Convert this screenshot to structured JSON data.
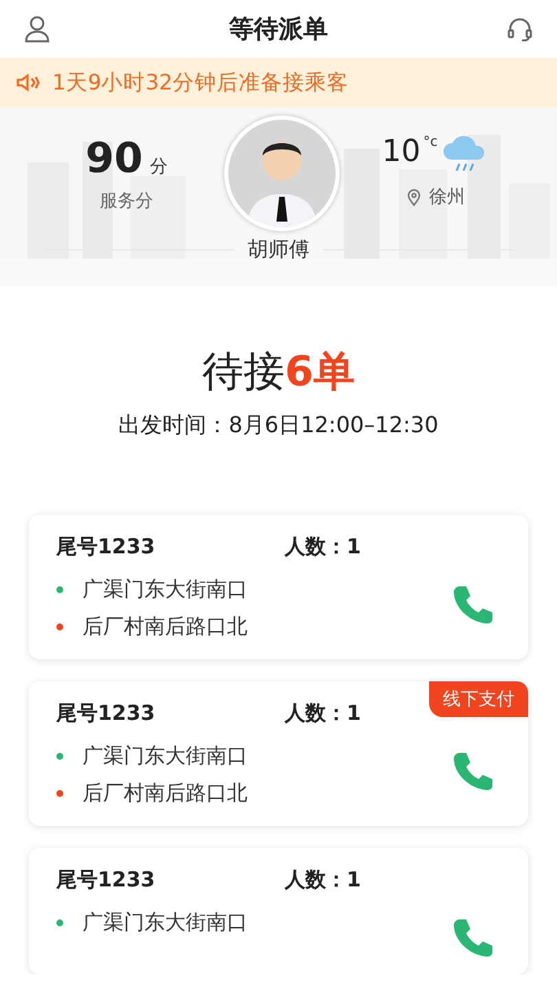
{
  "header": {
    "title": "等待派单"
  },
  "notice": {
    "text": "1天9小时32分钟后准备接乘客"
  },
  "driver": {
    "score": "90",
    "score_unit": "分",
    "score_label": "服务分",
    "temperature": "10",
    "temperature_unit": "°c",
    "city": "徐州",
    "name": "胡师傅"
  },
  "summary": {
    "title": "待接**6单**",
    "departure": "出发时间：8月6日12:00–12:30"
  },
  "orders": [
    {
      "tail": "尾号1233",
      "count": "人数：1",
      "stops": [
        {
          "address": "广渠门东大街南口",
          "color": "#2bb673"
        },
        {
          "address": "后厂村南后路口北",
          "color": "#f0451e"
        }
      ]
    },
    {
      "tail": "尾号1233",
      "count": "人数：1",
      "badge": "线下支付",
      "stops": [
        {
          "address": "广渠门东大街南口",
          "color": "#2bb673"
        },
        {
          "address": "后厂村南后路口北",
          "color": "#f0451e"
        }
      ]
    },
    {
      "tail": "尾号1233",
      "count": "人数：1",
      "stops": [
        {
          "address": "广渠门东大街南口",
          "color": "#2bb673"
        }
      ]
    }
  ]
}
